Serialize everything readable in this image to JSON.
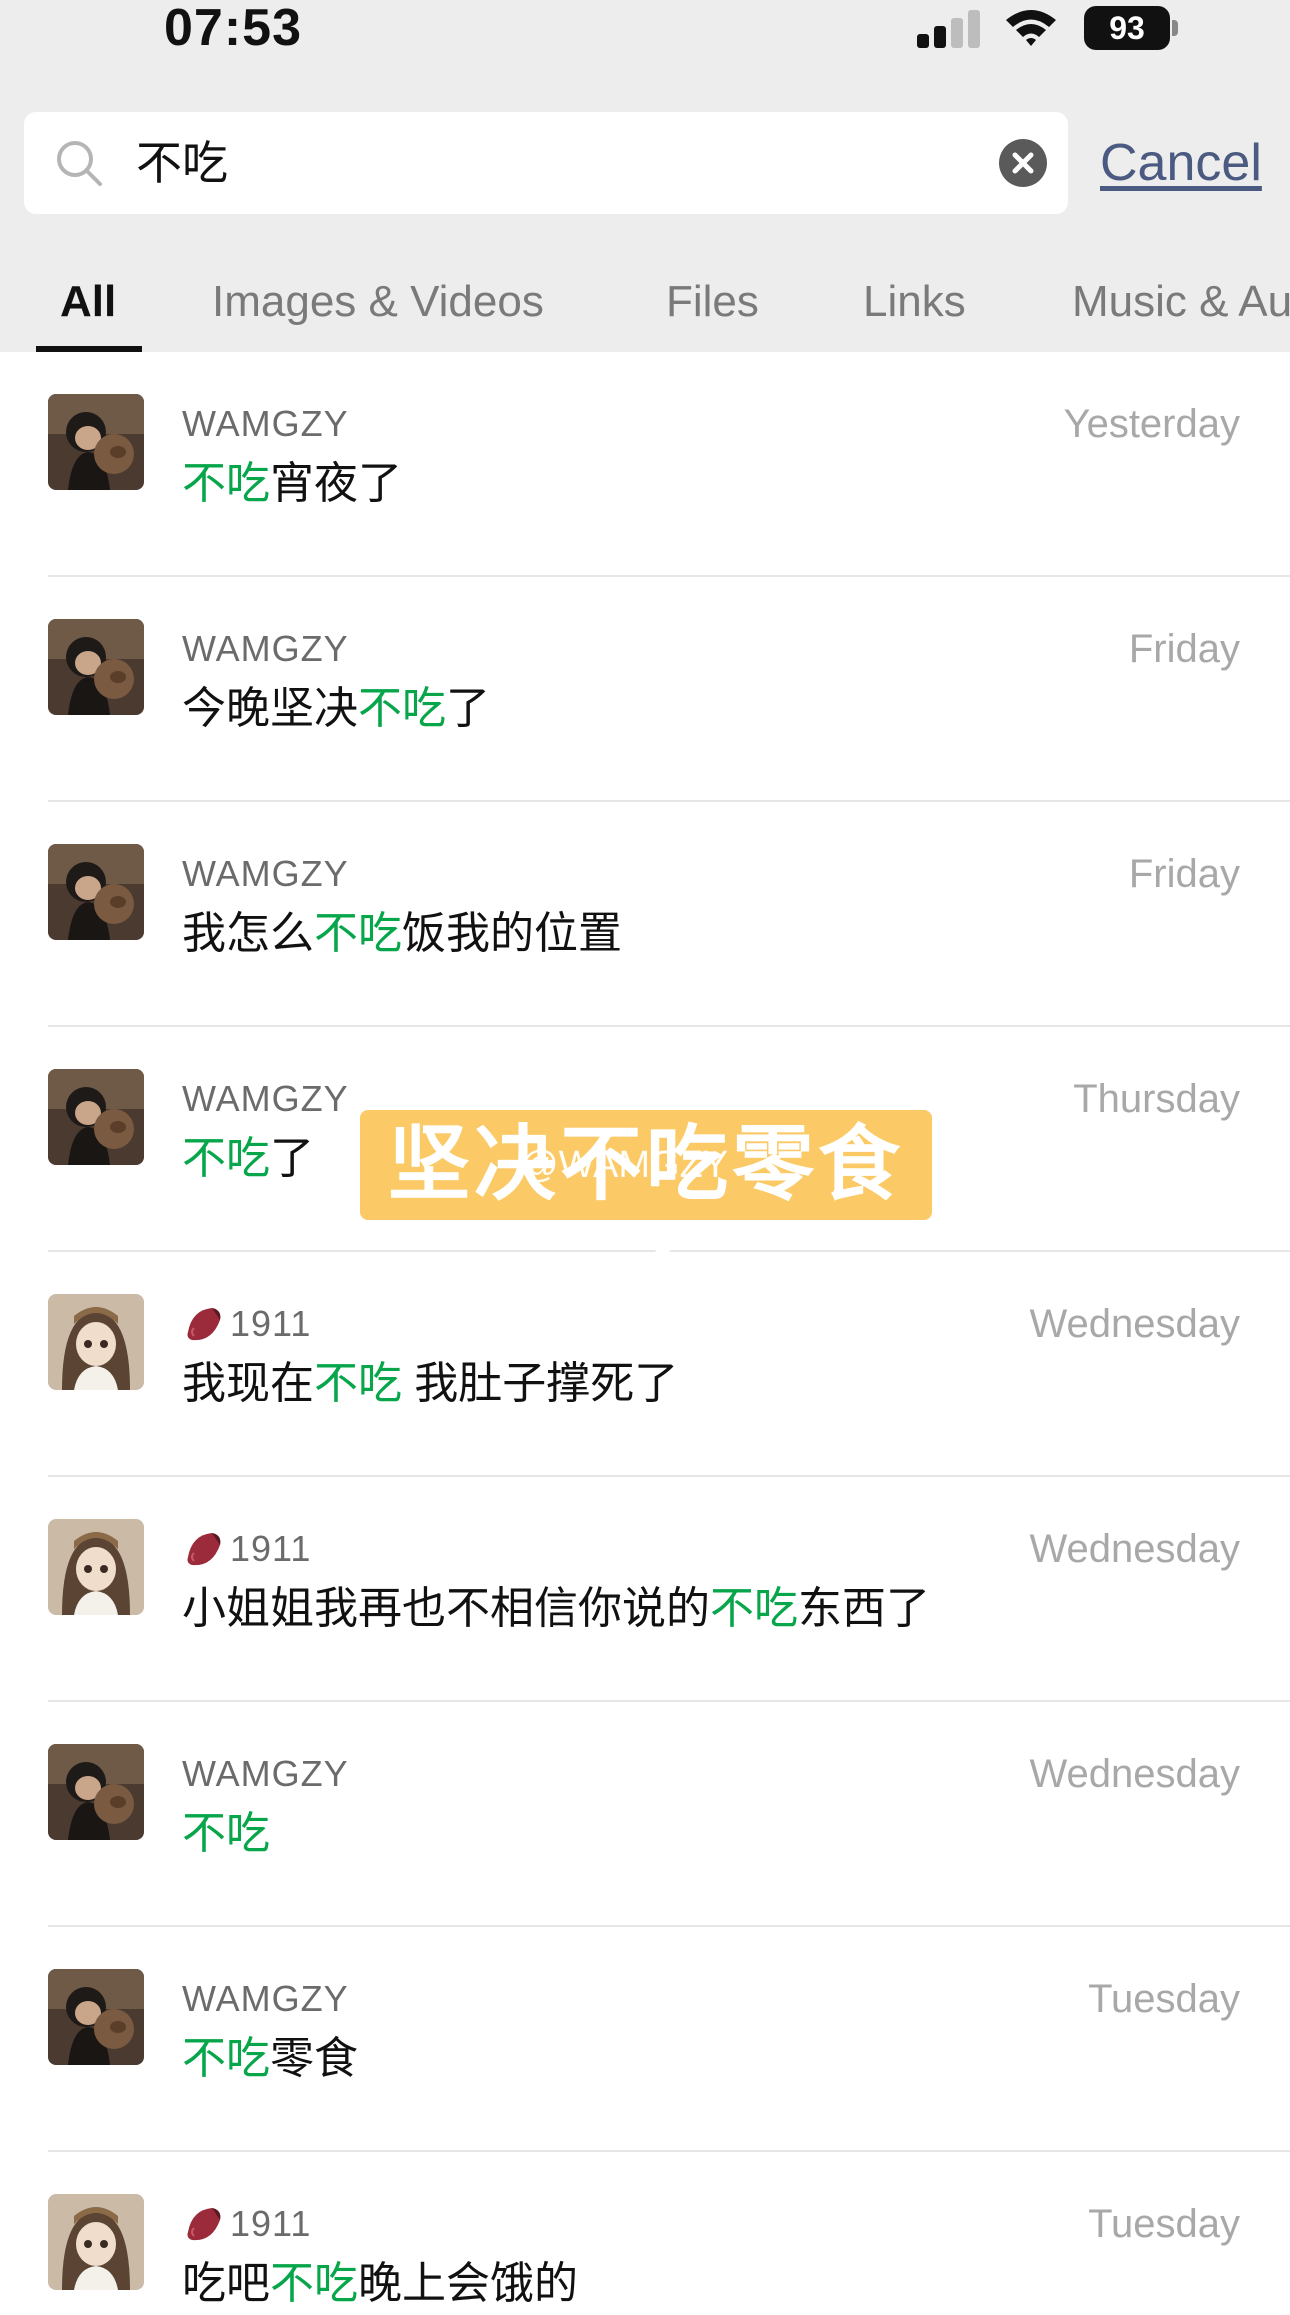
{
  "status_bar": {
    "time": "07:53",
    "battery": "93"
  },
  "search": {
    "value": "不吃",
    "cancel_label": "Cancel"
  },
  "tabs": [
    {
      "label": "All",
      "active": true
    },
    {
      "label": "Images & Videos",
      "active": false
    },
    {
      "label": "Files",
      "active": false
    },
    {
      "label": "Links",
      "active": false
    },
    {
      "label": "Music & Au",
      "active": false
    }
  ],
  "results": [
    {
      "sender": "WAMGZY",
      "sender_emoji": false,
      "avatar": "avatar-dark",
      "date": "Yesterday",
      "pre": "",
      "hl": "不吃",
      "post": "宵夜了"
    },
    {
      "sender": "WAMGZY",
      "sender_emoji": false,
      "avatar": "avatar-dark",
      "date": "Friday",
      "pre": "今晚坚决",
      "hl": "不吃",
      "post": "了"
    },
    {
      "sender": "WAMGZY",
      "sender_emoji": false,
      "avatar": "avatar-dark",
      "date": "Friday",
      "pre": "我怎么",
      "hl": "不吃",
      "post": "饭我的位置"
    },
    {
      "sender": "WAMGZY",
      "sender_emoji": false,
      "avatar": "avatar-dark",
      "date": "Thursday",
      "pre": "",
      "hl": "不吃",
      "post": "了"
    },
    {
      "sender": "1911",
      "sender_emoji": true,
      "avatar": "avatar-light",
      "date": "Wednesday",
      "pre": "我现在",
      "hl": "不吃",
      "post": " 我肚子撑死了"
    },
    {
      "sender": "1911",
      "sender_emoji": true,
      "avatar": "avatar-light",
      "date": "Wednesday",
      "pre": "小姐姐我再也不相信你说的",
      "hl": "不吃",
      "post": "东西了"
    },
    {
      "sender": "WAMGZY",
      "sender_emoji": false,
      "avatar": "avatar-dark",
      "date": "Wednesday",
      "pre": "",
      "hl": "不吃",
      "post": ""
    },
    {
      "sender": "WAMGZY",
      "sender_emoji": false,
      "avatar": "avatar-dark",
      "date": "Tuesday",
      "pre": "",
      "hl": "不吃",
      "post": "零食"
    },
    {
      "sender": "1911",
      "sender_emoji": true,
      "avatar": "avatar-light",
      "date": "Tuesday",
      "pre": "吃吧",
      "hl": "不吃",
      "post": "晚上会饿的"
    }
  ],
  "overlay": {
    "caption": "坚决不吃零食了",
    "handle": "@WAMGZY"
  },
  "colors": {
    "highlight": "#07a64a",
    "cancel": "#4a5a80",
    "header_bg": "#ededed"
  }
}
